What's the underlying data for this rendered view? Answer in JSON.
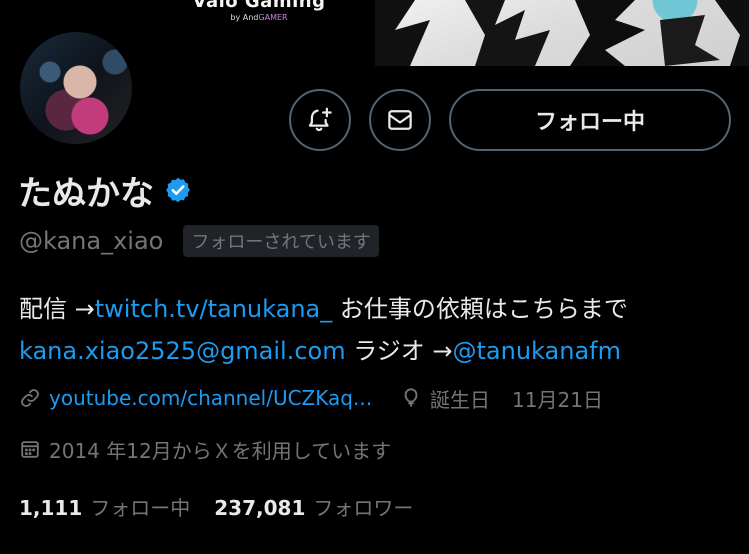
{
  "banner": {
    "brand_title": "Vaio Gaming",
    "brand_by": "by And",
    "brand_sub": "GAMER"
  },
  "profile": {
    "display_name": "たぬかな",
    "handle": "@kana_xiao",
    "follows_you": "フォローされています"
  },
  "actions": {
    "follow_label": "フォロー中",
    "notify_icon": "bell-plus-icon",
    "message_icon": "mail-icon"
  },
  "bio": {
    "line1_prefix": "配信 →",
    "line1_link": "twitch.tv/tanukana_",
    "line1_suffix": " お仕事の依頼はこちらまで",
    "line2_email": "kana.xiao2525@gmail.com",
    "line2_mid": " ラジオ →",
    "line2_mention": "@tanukanafm"
  },
  "meta": {
    "website": "youtube.com/channel/UCZKaq...",
    "birthday_label": "誕生日",
    "birthday_value": "11月21日",
    "joined": "2014 年12月からＸを利用しています"
  },
  "stats": {
    "following_count": "1,111",
    "following_label": "フォロー中",
    "followers_count": "237,081",
    "followers_label": "フォロワー"
  },
  "colors": {
    "background": "#000000",
    "text": "#e7e9ea",
    "muted": "#71767b",
    "link": "#1d9bf0",
    "border": "#536471"
  }
}
